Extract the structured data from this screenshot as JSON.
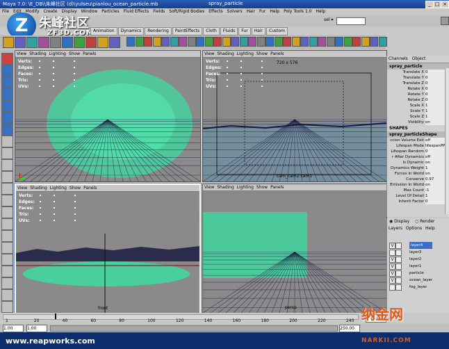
{
  "window": {
    "title": "Maya 7.0: \\E_DB\\\\朱峰社区 (d)\\yulseu\\pianlou_ocean_particle.mb",
    "center_title": "spray_particle"
  },
  "menubar": [
    "File",
    "Edit",
    "Modify",
    "Create",
    "Display",
    "Window",
    "Particles",
    "Fluid Effects",
    "Fields",
    "Soft/Rigid Bodies",
    "Effects",
    "Solvers",
    "Hair",
    "Fur",
    "Help",
    "Poly Tools 1.0",
    "Help"
  ],
  "statusline": {
    "sel_label": "sel ▾"
  },
  "shelf_tabs": [
    {
      "label": "Animation",
      "active": false
    },
    {
      "label": "Dynamics",
      "active": false
    },
    {
      "label": "Rendering",
      "active": false
    },
    {
      "label": "PaintEffects",
      "active": false
    },
    {
      "label": "Cloth",
      "active": false
    },
    {
      "label": "Fluids",
      "active": false
    },
    {
      "label": "Fur",
      "active": false
    },
    {
      "label": "Hair",
      "active": false
    },
    {
      "label": "Custom",
      "active": false
    }
  ],
  "logo": {
    "cn": "朱峰社区",
    "en": "ZF3D.COM",
    "mark": "Z"
  },
  "pane_menu": [
    "View",
    "Shading",
    "Lighting",
    "Show",
    "Panels"
  ],
  "hud_labels": [
    "Verts:",
    "Edges:",
    "Faces:",
    "Tris:",
    "UVs:"
  ],
  "viewports": {
    "top_right": {
      "resolution": "720 x 576",
      "camera": "cam_cam2:cam1"
    },
    "bottom_left": {
      "camera": "front"
    },
    "bottom_right": {
      "camera": "persp"
    }
  },
  "channel_box": {
    "menu": [
      "Channels",
      "Object"
    ],
    "object": "spray_particle",
    "attributes": [
      {
        "name": "Translate X",
        "value": "0"
      },
      {
        "name": "Translate Y",
        "value": "0"
      },
      {
        "name": "Translate Z",
        "value": "0"
      },
      {
        "name": "Rotate X",
        "value": "0"
      },
      {
        "name": "Rotate Y",
        "value": "0"
      },
      {
        "name": "Rotate Z",
        "value": "0"
      },
      {
        "name": "Scale X",
        "value": "1"
      },
      {
        "name": "Scale Y",
        "value": "1"
      },
      {
        "name": "Scale Z",
        "value": "1"
      },
      {
        "name": "Visibility",
        "value": "on"
      }
    ],
    "shapes_label": "SHAPES",
    "shape_name": "spray_particleShape",
    "shape_attributes": [
      {
        "name": "ccion Volume Exit",
        "value": "off"
      },
      {
        "name": "Lifespan Mode",
        "value": "lifespanPP o"
      },
      {
        "name": "Lifespan Random",
        "value": "0"
      },
      {
        "name": "r After Dynamics",
        "value": "off"
      },
      {
        "name": "Is Dynamic",
        "value": "on"
      },
      {
        "name": "Dynamics Weight",
        "value": "1"
      },
      {
        "name": "Forces In World",
        "value": "on"
      },
      {
        "name": "Conserve",
        "value": "0.97"
      },
      {
        "name": "Emission In World",
        "value": "on"
      },
      {
        "name": "Max Count",
        "value": "-1"
      },
      {
        "name": "Level Of Detail",
        "value": "1"
      },
      {
        "name": "Inherit Factor",
        "value": "0"
      }
    ]
  },
  "layers": {
    "radio_display": "Display",
    "radio_render": "Render",
    "menu": [
      "Layers",
      "Options",
      "Help"
    ],
    "items": [
      {
        "name": "layer4",
        "visible": "V",
        "selected": true
      },
      {
        "name": "layer3",
        "visible": "",
        "selected": false
      },
      {
        "name": "layer2",
        "visible": "V",
        "selected": false
      },
      {
        "name": "layer1",
        "visible": "V",
        "selected": false
      },
      {
        "name": "particle",
        "visible": "V",
        "selected": false
      },
      {
        "name": "ocean_layer",
        "visible": "V",
        "selected": false
      },
      {
        "name": "fog_layer",
        "visible": "",
        "selected": false
      }
    ]
  },
  "time_slider": {
    "ticks": [
      "1",
      "20",
      "40",
      "60",
      "80",
      "100",
      "120",
      "140",
      "160",
      "180",
      "200",
      "220",
      "240"
    ],
    "current": "36.00"
  },
  "range_slider": {
    "start": "1.00",
    "range_start": "1.00",
    "range_end": "250.00"
  },
  "watermark_left": "www.reapworks.com",
  "watermark_right": {
    "cn": "纳金网",
    "en": "NARKII.COM"
  },
  "colors": {
    "viewport_bg": "#8a8a8a",
    "particle": "#3dd9a0",
    "wire_dark": "#1a1a40",
    "accent_blue": "#2a5fb8"
  }
}
